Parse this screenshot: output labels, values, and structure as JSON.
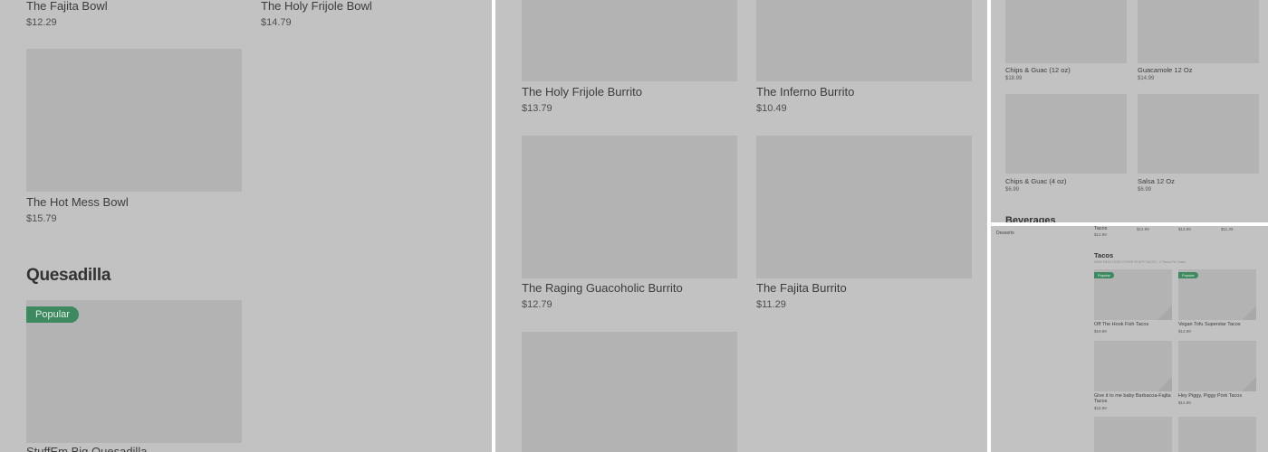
{
  "panel1": {
    "items": [
      {
        "name": "The Fajita Bowl",
        "price": "$12.29"
      },
      {
        "name": "The Holy Frijole Bowl",
        "price": "$14.79"
      },
      {
        "name": "The Hot Mess Bowl",
        "price": "$15.79"
      }
    ],
    "section_title": "Quesadilla",
    "badge": "Popular",
    "quesadilla_item": "StuffEm Big Quesadilla"
  },
  "panel2": {
    "items": [
      {
        "name": "The Holy Frijole Burrito",
        "price": "$13.79"
      },
      {
        "name": "The Inferno Burrito",
        "price": "$10.49"
      },
      {
        "name": "The Raging Guacoholic Burrito",
        "price": "$12.79"
      },
      {
        "name": "The Fajita Burrito",
        "price": "$11.29"
      }
    ]
  },
  "panel3": {
    "items": [
      {
        "name": "Chips & Guac (12 oz)",
        "price": "$18.99"
      },
      {
        "name": "Guacamole 12 Oz",
        "price": "$14.99"
      },
      {
        "name": "Chips & Guac (4 oz)",
        "price": "$6.99"
      },
      {
        "name": "Salsa 12 Oz",
        "price": "$6.99"
      }
    ],
    "next_section": "Beverages"
  },
  "panel4": {
    "sidebar_item": "Desserts",
    "top_row": {
      "label": "Tacos",
      "prices": [
        "$12.99",
        "$12.99",
        "$13.99",
        "$11.29"
      ]
    },
    "section_title": "Tacos",
    "section_subtitle": "NOW MEAT LESS OTHER STUFF TACOS - 3 Tacos Per Order",
    "badge": "Popular",
    "items": [
      {
        "name": "Off The Hook Fish Tacos",
        "price": "$19.99"
      },
      {
        "name": "Vegan Tofu Superstar Tacos",
        "price": "$13.99"
      },
      {
        "name": "Give it to me baby Barbacoa-Fajita Tacos",
        "price": "$18.99"
      },
      {
        "name": "Hey Piggy, Piggy Pork Tacos",
        "price": "$14.99"
      }
    ]
  }
}
